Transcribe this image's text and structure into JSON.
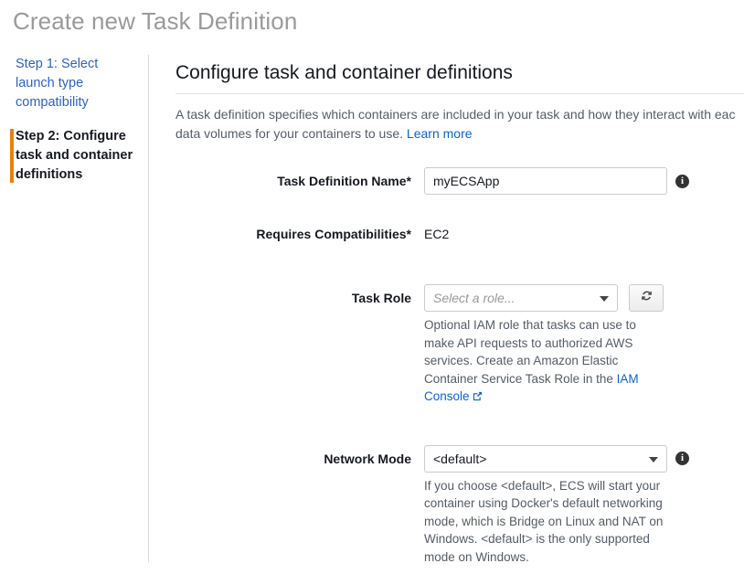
{
  "page_title": "Create new Task Definition",
  "sidebar": {
    "steps": [
      {
        "label": "Step 1: Select launch type compatibility",
        "state": "link"
      },
      {
        "label": "Step 2: Configure task and container definitions",
        "state": "current"
      }
    ]
  },
  "content": {
    "section_title": "Configure task and container definitions",
    "intro_line1": "A task definition specifies which containers are included in your task and how they interact with eac",
    "intro_line2": "data volumes for your containers to use.",
    "learn_more": "Learn more"
  },
  "form": {
    "task_definition_name": {
      "label": "Task Definition Name*",
      "value": "myECSApp",
      "placeholder": "",
      "info": "i"
    },
    "requires_compatibilities": {
      "label": "Requires Compatibilities*",
      "value": "EC2"
    },
    "task_role": {
      "label": "Task Role",
      "placeholder": "Select a role...",
      "help_line1": "Optional IAM role that tasks can use to make API",
      "help_line2": "requests to authorized AWS services. Create an",
      "help_line3": "Amazon Elastic Container Service Task Role in the",
      "help_link": "IAM Console"
    },
    "network_mode": {
      "label": "Network Mode",
      "value": "<default>",
      "info": "i",
      "help_line1": "If you choose <default>, ECS will start your",
      "help_line2": "container using Docker's default networking",
      "help_line3": "mode, which is Bridge on Linux and NAT on",
      "help_line4": "Windows. <default> is the only supported mode",
      "help_line5": "on Windows."
    }
  },
  "colors": {
    "accent_orange": "#e8810c",
    "link_blue": "#0b63ce",
    "step_link_blue": "#2a63c6",
    "title_gray": "#9a9a9a"
  }
}
